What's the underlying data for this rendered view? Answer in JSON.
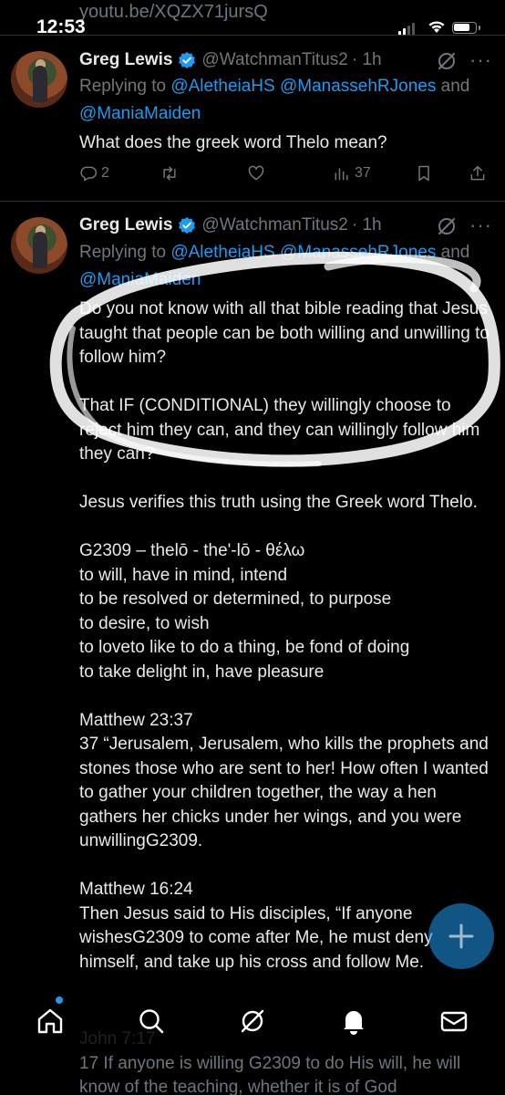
{
  "status_bar": {
    "peek_link": "youtu.be/XQZX71jursQ",
    "time": "12:53"
  },
  "tweet1": {
    "name": "Greg Lewis",
    "handle": "@WatchmanTitus2",
    "time": "· 1h",
    "replying_prefix": "Replying to ",
    "mentions": [
      "@AletheiaHS",
      "@ManassehRJones",
      "@ManiaMaiden"
    ],
    "and_word": "and ",
    "text": "What does the greek word Thelo mean?",
    "actions": {
      "replies": "2",
      "retweets": "",
      "likes": "",
      "views": "37"
    }
  },
  "tweet2": {
    "name": "Greg Lewis",
    "handle": "@WatchmanTitus2",
    "time": "· 1h",
    "replying_prefix": "Replying to ",
    "mentions": [
      "@AletheiaHS",
      "@ManassehRJones",
      "@ManiaMaiden"
    ],
    "and_word": "and ",
    "text": "Do you not know with all that bible reading that Jesus taught that people can be both willing and unwilling to follow him?\n\nThat IF (CONDITIONAL) they willingly choose to reject him they can, and they can willingly follow him they can?\n\nJesus verifies this truth using the Greek word Thelo.\n\nG2309 – thelō - the'-lō - θέλω\nto will, have in mind, intend\nto be resolved or determined, to purpose\nto desire, to wish\nto loveto like to do a thing, be fond of doing\nto take delight in, have pleasure\n\nMatthew 23:37\n37 “Jerusalem, Jerusalem, who kills the prophets and stones those who are sent to her! How often I wanted to gather your children together, the way a hen gathers her chicks under her wings, and you were unwillingG2309.\n\nMatthew 16:24\nThen Jesus said to His disciples, “If anyone wishesG2309 to come after Me, he must deny himself, and take up his cross and follow Me.",
    "tail_text": "John 7:17\n17 If anyone is willing G2309 to do His will, he will know of the teaching, whether it is of God"
  },
  "bottom_nav": {
    "items": [
      "home-icon",
      "search-icon",
      "grok-icon",
      "bell-icon",
      "mail-icon"
    ]
  },
  "colors": {
    "background": "#000000",
    "text": "#e7e9ea",
    "muted": "#71767b",
    "accent": "#1d9bf0"
  }
}
